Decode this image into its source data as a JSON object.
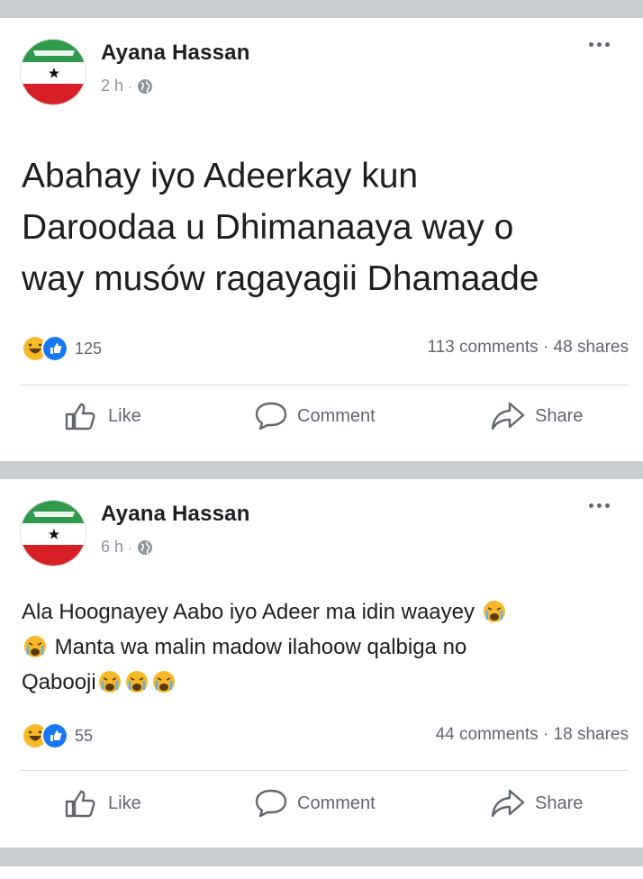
{
  "colors": {
    "feed_bg": "#c9ccd1",
    "text": "#1c1e21",
    "meta": "#8d949e",
    "action": "#606770",
    "like_blue": "#1877f2",
    "haha_yellow": "#f7b928"
  },
  "posts": [
    {
      "author": "Ayana Hassan",
      "time": "2 h",
      "separator": "·",
      "text_lines": [
        "Abahay iyo Adeerkay kun",
        "Daroodaa u Dhimanaaya way o",
        "way musów ragayagii Dhamaade"
      ],
      "reaction_icons": [
        "haha-icon",
        "like-icon"
      ],
      "reaction_count": "125",
      "comments": "113 comments",
      "shares": "48 shares",
      "actions": {
        "like": "Like",
        "comment": "Comment",
        "share": "Share"
      }
    },
    {
      "author": "Ayana Hassan",
      "time": "6 h",
      "separator": "·",
      "text_parts": [
        "Ala Hoognayey Aabo iyo Adeer ma idin waayey",
        "Manta wa malin madow ilahoow qalbiga no",
        "Qabooji"
      ],
      "reaction_icons": [
        "haha-icon",
        "like-icon"
      ],
      "reaction_count": "55",
      "comments": "44 comments",
      "shares": "18 shares",
      "actions": {
        "like": "Like",
        "comment": "Comment",
        "share": "Share"
      }
    }
  ],
  "stats_separator": "·"
}
